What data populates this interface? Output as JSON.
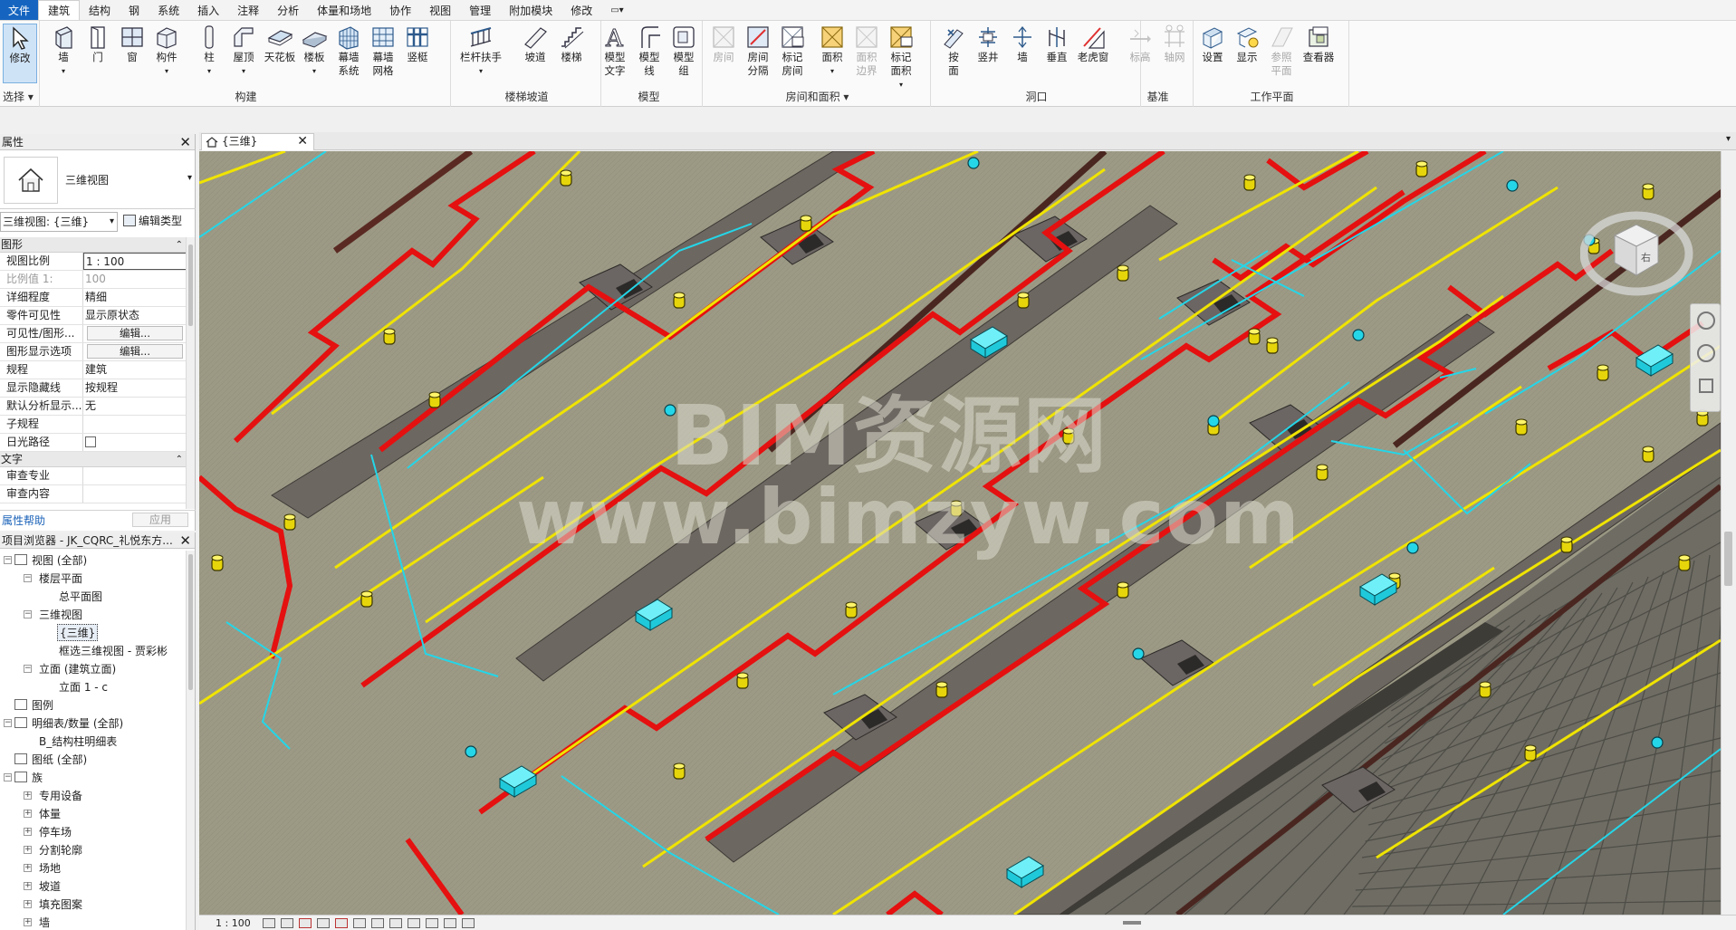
{
  "menu": {
    "file": "文件",
    "tabs": [
      "建筑",
      "结构",
      "钢",
      "系统",
      "插入",
      "注释",
      "分析",
      "体量和场地",
      "协作",
      "视图",
      "管理",
      "附加模块",
      "修改"
    ],
    "active": "建筑"
  },
  "ribbon": {
    "select": {
      "tool": "修改",
      "title": "选择"
    },
    "build": {
      "title": "构建",
      "tools": [
        "墙",
        "门",
        "窗",
        "构件",
        "柱",
        "屋顶",
        "天花板",
        "楼板",
        "幕墙\n系统",
        "幕墙\n网格",
        "竖梃"
      ]
    },
    "stair": {
      "title": "楼梯坡道",
      "tools": [
        "栏杆扶手",
        "坡道",
        "楼梯"
      ]
    },
    "model": {
      "title": "模型",
      "tools": [
        "模型\n文字",
        "模型\n线",
        "模型\n组"
      ]
    },
    "room": {
      "title": "房间和面积",
      "tools": [
        "房间",
        "房间\n分隔",
        "标记\n房间",
        "面积",
        "面积\n边界",
        "标记\n面积"
      ]
    },
    "opening": {
      "title": "洞口",
      "tools": [
        "按\n面",
        "竖井",
        "墙",
        "垂直",
        "老虎窗"
      ]
    },
    "datum": {
      "title": "基准",
      "tools": [
        "标高",
        "轴网"
      ]
    },
    "workplane": {
      "title": "工作平面",
      "tools": [
        "设置",
        "显示",
        "参照\n平面",
        "查看器"
      ]
    }
  },
  "properties": {
    "title": "属性",
    "type_name": "三维视图",
    "view_selector": "三维视图: {三维}",
    "edit_type": "编辑类型",
    "categories": {
      "graphics": "图形",
      "text": "文字"
    },
    "rows": [
      {
        "k": "视图比例",
        "v": "1 : 100"
      },
      {
        "k": "比例值 1:",
        "v": "100"
      },
      {
        "k": "详细程度",
        "v": "精细"
      },
      {
        "k": "零件可见性",
        "v": "显示原状态"
      },
      {
        "k": "可见性/图形...",
        "v": "编辑..."
      },
      {
        "k": "图形显示选项",
        "v": "编辑..."
      },
      {
        "k": "规程",
        "v": "建筑"
      },
      {
        "k": "显示隐藏线",
        "v": "按规程"
      },
      {
        "k": "默认分析显示...",
        "v": "无"
      },
      {
        "k": "子规程",
        "v": ""
      },
      {
        "k": "日光路径",
        "v": ""
      }
    ],
    "text_rows": [
      {
        "k": "审查专业",
        "v": ""
      },
      {
        "k": "审查内容",
        "v": ""
      }
    ],
    "help": "属性帮助",
    "apply": "应用"
  },
  "browser": {
    "title": "项目浏览器 - JK_CQRC_礼悦东方...",
    "nodes": [
      {
        "label": "视图 (全部)",
        "level": 0,
        "exp": "-"
      },
      {
        "label": "楼层平面",
        "level": 1,
        "exp": "-"
      },
      {
        "label": "总平面图",
        "level": 2,
        "exp": ""
      },
      {
        "label": "三维视图",
        "level": 1,
        "exp": "-"
      },
      {
        "label": "{三维}",
        "level": 2,
        "exp": "",
        "sel": true
      },
      {
        "label": "框选三维视图 - 贾彩彬",
        "level": 2,
        "exp": ""
      },
      {
        "label": "立面 (建筑立面)",
        "level": 1,
        "exp": "-"
      },
      {
        "label": "立面 1 - c",
        "level": 2,
        "exp": ""
      },
      {
        "label": "图例",
        "level": 0,
        "exp": ""
      },
      {
        "label": "明细表/数量 (全部)",
        "level": 0,
        "exp": "-"
      },
      {
        "label": "B_结构柱明细表",
        "level": 1,
        "exp": ""
      },
      {
        "label": "图纸 (全部)",
        "level": 0,
        "exp": ""
      },
      {
        "label": "族",
        "level": 0,
        "exp": "-"
      },
      {
        "label": "专用设备",
        "level": 1,
        "exp": "+"
      },
      {
        "label": "体量",
        "level": 1,
        "exp": "+"
      },
      {
        "label": "停车场",
        "level": 1,
        "exp": "+"
      },
      {
        "label": "分割轮廓",
        "level": 1,
        "exp": "+"
      },
      {
        "label": "场地",
        "level": 1,
        "exp": "+"
      },
      {
        "label": "坡道",
        "level": 1,
        "exp": "+"
      },
      {
        "label": "填充图案",
        "level": 1,
        "exp": "+"
      },
      {
        "label": "墙",
        "level": 1,
        "exp": "+"
      }
    ]
  },
  "view": {
    "tab": "{三维}",
    "scale": "1 : 100",
    "watermark_line1": "BIM资源网",
    "watermark_line2": "www.bimzyw.com",
    "viewcube_label": "右"
  },
  "colors": {
    "file_menu": "#1565c0",
    "red_beam": "#e51010",
    "yellow_pipe": "#f0e400",
    "cyan_pipe": "#24d6e8",
    "floor": "#9c9a85"
  }
}
